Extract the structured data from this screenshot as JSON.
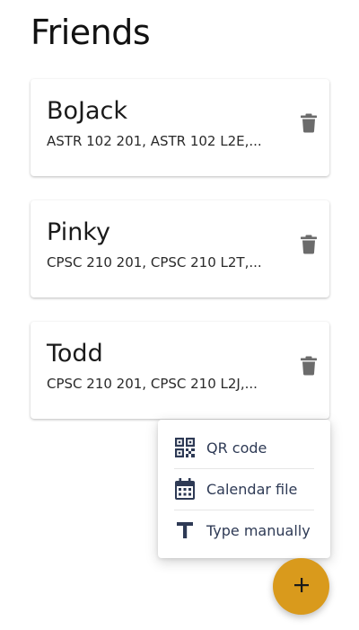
{
  "header": {
    "title": "Friends"
  },
  "friends": [
    {
      "name": "BoJack",
      "courses": "ASTR 102 201, ASTR 102 L2E,..."
    },
    {
      "name": "Pinky",
      "courses": "CPSC 210 201, CPSC 210 L2T,..."
    },
    {
      "name": "Todd",
      "courses": "CPSC 210 201, CPSC 210 L2J,..."
    }
  ],
  "add_menu": {
    "items": [
      {
        "label": "QR code",
        "icon": "qr-code-icon"
      },
      {
        "label": "Calendar file",
        "icon": "calendar-icon"
      },
      {
        "label": "Type manually",
        "icon": "text-icon"
      }
    ]
  },
  "fab": {
    "label": "+",
    "icon": "plus-icon"
  },
  "colors": {
    "accent": "#d99a1c",
    "menu_text": "#2e3a55",
    "icon_grey": "#6b6b6b"
  }
}
